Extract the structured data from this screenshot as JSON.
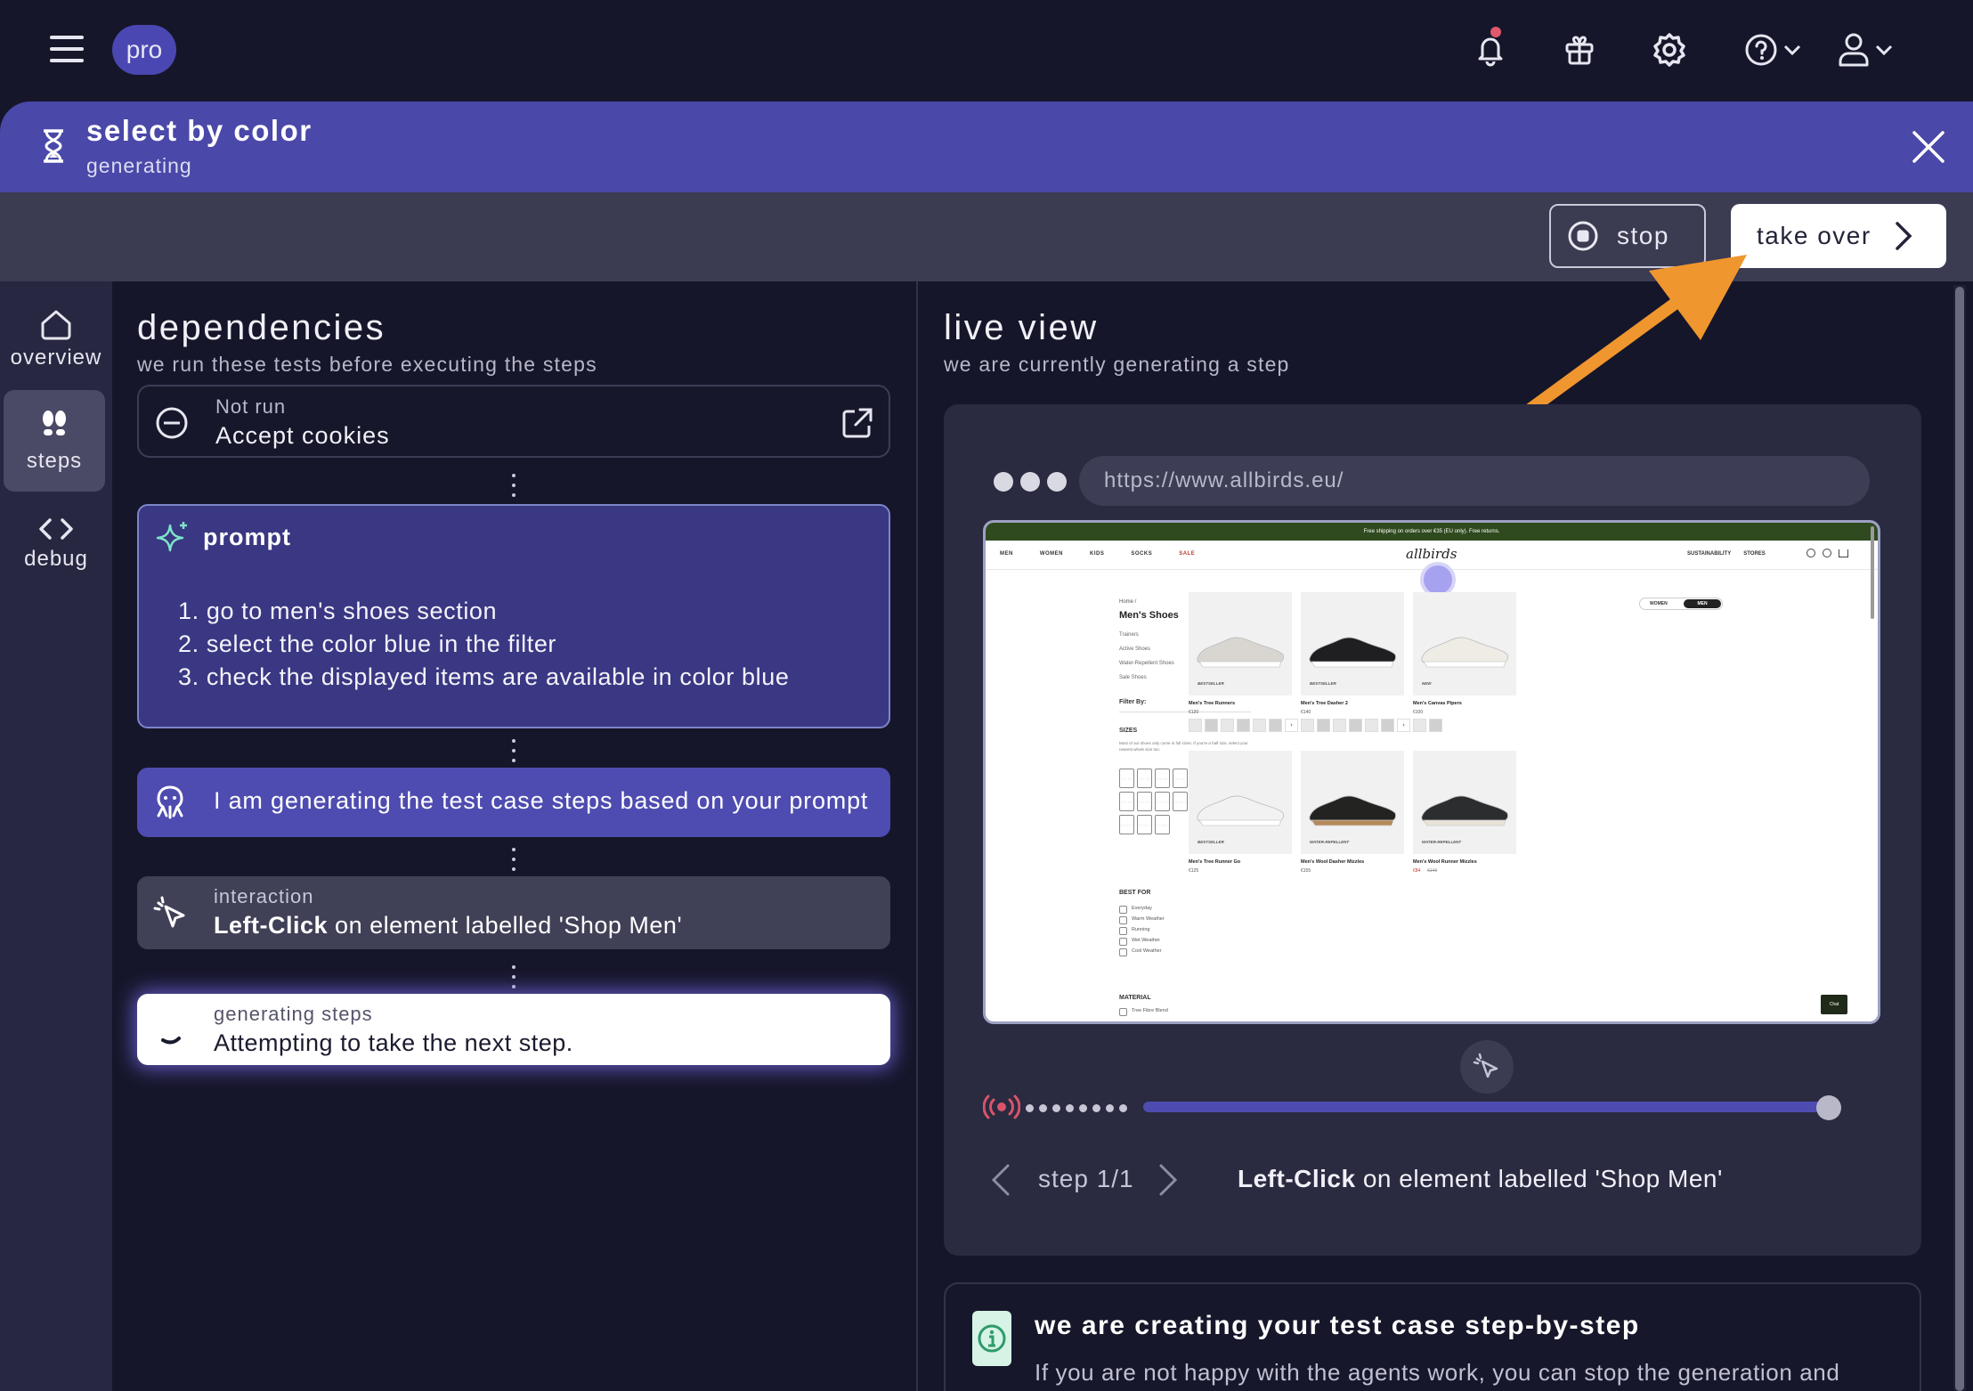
{
  "nav": {
    "pro_badge": "pro"
  },
  "banner": {
    "title": "select by color",
    "status": "generating"
  },
  "actions": {
    "stop_label": "stop",
    "takeover_label": "take over"
  },
  "sidebar": {
    "items": [
      {
        "label": "overview",
        "icon": "home-icon"
      },
      {
        "label": "steps",
        "icon": "footsteps-icon",
        "active": true
      },
      {
        "label": "debug",
        "icon": "code-icon"
      }
    ]
  },
  "dependencies": {
    "title": "dependencies",
    "subtitle": "we run these tests before executing the steps",
    "card_status": "Not run",
    "card_name": "Accept cookies"
  },
  "prompt": {
    "label": "prompt",
    "lines": [
      "go to men's shoes section",
      "select the color blue in the filter",
      "check the displayed items are available in color blue"
    ],
    "numbers": [
      "1.",
      "2.",
      "3."
    ]
  },
  "generating": {
    "text": "I am generating the test case steps based on your prompt"
  },
  "interaction": {
    "label": "interaction",
    "action": "Left-Click",
    "rest": "on element labelled 'Shop Men'"
  },
  "generating_steps": {
    "label": "generating steps",
    "text": "Attempting to take the next step."
  },
  "live_view": {
    "title": "live view",
    "subtitle": "we are currently generating a step",
    "url": "https://www.allbirds.eu/",
    "progress": 1.0
  },
  "step_nav": {
    "counter": "step 1/1",
    "action": "Left-Click",
    "rest": "on element labelled 'Shop Men'"
  },
  "info": {
    "title": "we are creating your test case step-by-step",
    "text": "If you are not happy with the agents work, you can stop the generation and"
  },
  "site": {
    "announcement": "Free shipping on orders over €35 (EU only). Free returns.",
    "nav_left": [
      "MEN",
      "WOMEN",
      "KIDS",
      "SOCKS",
      "SALE"
    ],
    "logo": "allbirds",
    "nav_right": [
      "SUSTAINABILITY",
      "STORES"
    ],
    "breadcrumb": "Home /",
    "heading": "Men's Shoes",
    "categories": [
      "Trainers",
      "Active Shoes",
      "Water-Repellent Shoes",
      "Sale Shoes"
    ],
    "filter_by": "Filter By:",
    "sizes_label": "SIZES",
    "sizes_note": "Most of our shoes only come in full sizes. If you're a half size, select your nearest whole size too.",
    "sizes": [
      "EU 41",
      "EU 42",
      "EU 43",
      "EU 44",
      "EU 45",
      "EU 46",
      "EU 47",
      "EU 41.5",
      "EU 42.5",
      "EU 43.5",
      "EU 44.5",
      "EU 45.5",
      "EU 46.5"
    ],
    "best_for_label": "BEST FOR",
    "best_for": [
      "Everyday",
      "Warm Weather",
      "Running",
      "Wet Weather",
      "Cool Weather"
    ],
    "material_label": "MATERIAL",
    "material_first": "Tree Fibre Blend",
    "toggle": [
      "WOMEN",
      "MEN"
    ],
    "products": [
      {
        "badge": "BESTSELLER",
        "name": "Men's Tree Runners",
        "price": "€120"
      },
      {
        "badge": "BESTSELLER",
        "name": "Men's Tree Dasher 2",
        "price": "€140"
      },
      {
        "badge": "NEW",
        "name": "Men's Canvas Pipers",
        "price": "€100"
      },
      {
        "badge": "BESTSELLER",
        "name": "Men's Tree Runner Go",
        "price": "€125"
      },
      {
        "badge": "WATER-REPELLENT",
        "name": "Men's Wool Dasher Mizzles",
        "price": "€155"
      },
      {
        "badge": "WATER-REPELLENT",
        "name": "Men's Wool Runner Mizzles",
        "price": "€84",
        "old_price": "€140"
      }
    ],
    "chat": "Chat"
  },
  "colors": {
    "accent": "#4a48a8",
    "generating": "#4e4cb0",
    "arrow": "#f0962e",
    "notification": "#e0586b",
    "info_icon": "#2f9a6a"
  }
}
